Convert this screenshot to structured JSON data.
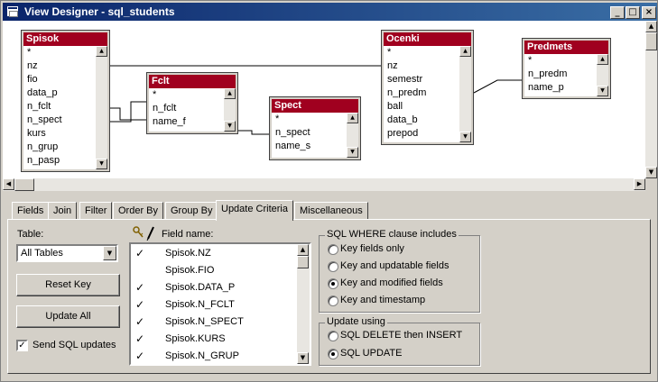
{
  "window": {
    "title": "View Designer - sql_students",
    "controls": [
      "_",
      "□",
      "×"
    ]
  },
  "tables": [
    {
      "name": "Spisok",
      "fields": [
        "*",
        "nz",
        "fio",
        "data_p",
        "n_fclt",
        "n_spect",
        "kurs",
        "n_grup",
        "n_pasp"
      ]
    },
    {
      "name": "Fclt",
      "fields": [
        "*",
        "n_fclt",
        "name_f"
      ]
    },
    {
      "name": "Spect",
      "fields": [
        "*",
        "n_spect",
        "name_s"
      ]
    },
    {
      "name": "Ocenki",
      "fields": [
        "*",
        "nz",
        "semestr",
        "n_predm",
        "ball",
        "data_b",
        "prepod"
      ]
    },
    {
      "name": "Predmets",
      "fields": [
        "*",
        "n_predm",
        "name_p"
      ]
    }
  ],
  "tabs": [
    "Fields",
    "Join",
    "Filter",
    "Order By",
    "Group By",
    "Update Criteria",
    "Miscellaneous"
  ],
  "active_tab": "Update Criteria",
  "criteria": {
    "table_label": "Table:",
    "table_value": "All Tables",
    "reset_key": "Reset Key",
    "update_all": "Update All",
    "send_sql": "Send SQL updates",
    "send_sql_checked": true,
    "field_name_label": "Field name:",
    "fields": [
      {
        "name": "Spisok.NZ",
        "checked": true
      },
      {
        "name": "Spisok.FIO",
        "checked": false
      },
      {
        "name": "Spisok.DATA_P",
        "checked": true
      },
      {
        "name": "Spisok.N_FCLT",
        "checked": true
      },
      {
        "name": "Spisok.N_SPECT",
        "checked": true
      },
      {
        "name": "Spisok.KURS",
        "checked": true
      },
      {
        "name": "Spisok.N_GRUP",
        "checked": true
      }
    ],
    "where_group": {
      "title": "SQL WHERE clause includes",
      "options": [
        "Key fields only",
        "Key and updatable fields",
        "Key and modified fields",
        "Key and timestamp"
      ],
      "selected": 2
    },
    "update_group": {
      "title": "Update using",
      "options": [
        "SQL DELETE then INSERT",
        "SQL UPDATE"
      ],
      "selected": 1
    }
  }
}
